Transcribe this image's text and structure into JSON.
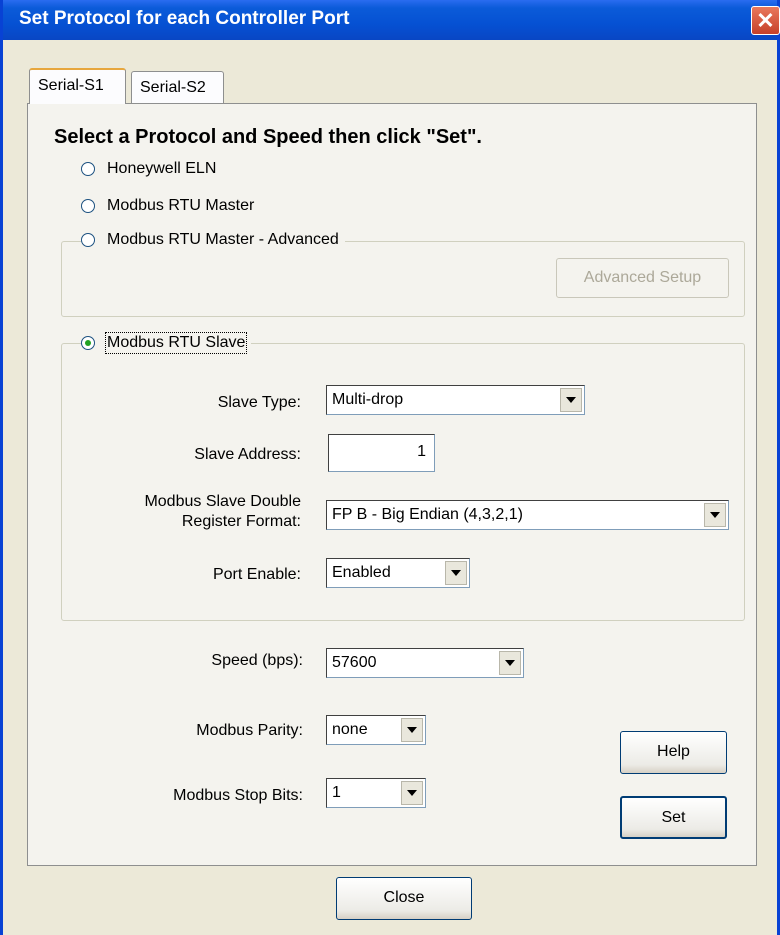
{
  "window": {
    "title": "Set Protocol for each Controller Port",
    "close_glyph": "✕"
  },
  "tabs": [
    {
      "label": "Serial-S1",
      "active": true
    },
    {
      "label": "Serial-S2",
      "active": false
    }
  ],
  "heading": "Select a Protocol and Speed then click \"Set\".",
  "protocols": [
    {
      "label": "Honeywell ELN",
      "selected": false
    },
    {
      "label": "Modbus RTU Master",
      "selected": false
    },
    {
      "label": "Modbus RTU Master - Advanced",
      "selected": false
    },
    {
      "label": "Modbus RTU Slave",
      "selected": true
    }
  ],
  "advanced_setup_label": "Advanced Setup",
  "slave": {
    "type_label": "Slave Type:",
    "type_value": "Multi-drop",
    "address_label": "Slave Address:",
    "address_value": "1",
    "format_label_1": "Modbus Slave Double",
    "format_label_2": "Register Format:",
    "format_value": "FP B - Big Endian (4,3,2,1)",
    "port_enable_label": "Port Enable:",
    "port_enable_value": "Enabled"
  },
  "speed": {
    "label": "Speed (bps):",
    "value": "57600"
  },
  "parity": {
    "label": "Modbus Parity:",
    "value": "none"
  },
  "stop_bits": {
    "label": "Modbus Stop Bits:",
    "value": "1"
  },
  "buttons": {
    "help": "Help",
    "set": "Set",
    "close": "Close"
  },
  "colors": {
    "titlebar": "#0651d3",
    "dialog_bg": "#ece9d8",
    "panel_bg": "#f4f3ee",
    "close_red": "#c6402a",
    "radio_dot": "#21a121"
  }
}
